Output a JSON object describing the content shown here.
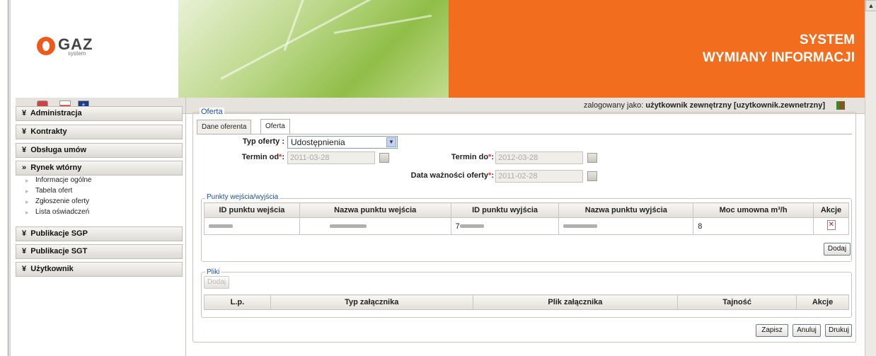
{
  "header": {
    "logo_text": "GAZ",
    "logo_sub": "system",
    "title_line1": "SYSTEM",
    "title_line2": "WYMIANY INFORMACJI"
  },
  "toolbar": {
    "logged_label": "zalogowany jako:",
    "user": "użytkownik zewnętrzny [uzytkownik.zewnetrzny]",
    "icons": [
      "home-icon",
      "polish-flag-icon",
      "english-flag-icon",
      "logout-icon"
    ]
  },
  "sidebar": {
    "sections": [
      {
        "label": "Administracja",
        "marker": "¥"
      },
      {
        "label": "Kontrakty",
        "marker": "¥"
      },
      {
        "label": "Obsługa umów",
        "marker": "¥"
      },
      {
        "label": "Rynek wtórny",
        "marker": "»"
      },
      {
        "label": "Publikacje SGP",
        "marker": "¥"
      },
      {
        "label": "Publikacje SGT",
        "marker": "¥"
      },
      {
        "label": "Użytkownik",
        "marker": "¥"
      }
    ],
    "rynek_items": [
      "Informacje ogólne",
      "Tabela ofert",
      "Zgłoszenie oferty",
      "Lista oświadczeń"
    ]
  },
  "form": {
    "legend": "Oferta",
    "tabs": [
      "Dane oferenta",
      "Oferta"
    ],
    "typ_oferty_label": "Typ oferty :",
    "typ_oferty_value": "Udostępnienia",
    "termin_od_label": "Termin od",
    "termin_od_value": "2011-03-28",
    "termin_do_label": "Termin do",
    "termin_do_value": "2012-03-28",
    "data_waznosci_label": "Data ważności oferty",
    "data_waznosci_value": "2011-02-28",
    "req_mark": "*",
    "colon": ":"
  },
  "punkty": {
    "legend": "Punkty wejścia/wyjścia",
    "columns": [
      "ID punktu wejścia",
      "Nazwa punktu wejścia",
      "ID punktu wyjścia",
      "Nazwa punktu wyjścia",
      "Moc umowna m³/h",
      "Akcje"
    ],
    "rows": [
      {
        "id_wej": "",
        "nazwa_wej": "",
        "id_wyj": "7",
        "nazwa_wyj": "",
        "moc": "8"
      }
    ],
    "add_button": "Dodaj"
  },
  "pliki": {
    "legend": "Pliki",
    "add_button": "Dodaj",
    "columns": [
      "L.p.",
      "Typ załącznika",
      "Plik załącznika",
      "Tajność",
      "Akcje"
    ]
  },
  "actions": {
    "save": "Zapisz",
    "cancel": "Anuluj",
    "print": "Drukuj"
  }
}
